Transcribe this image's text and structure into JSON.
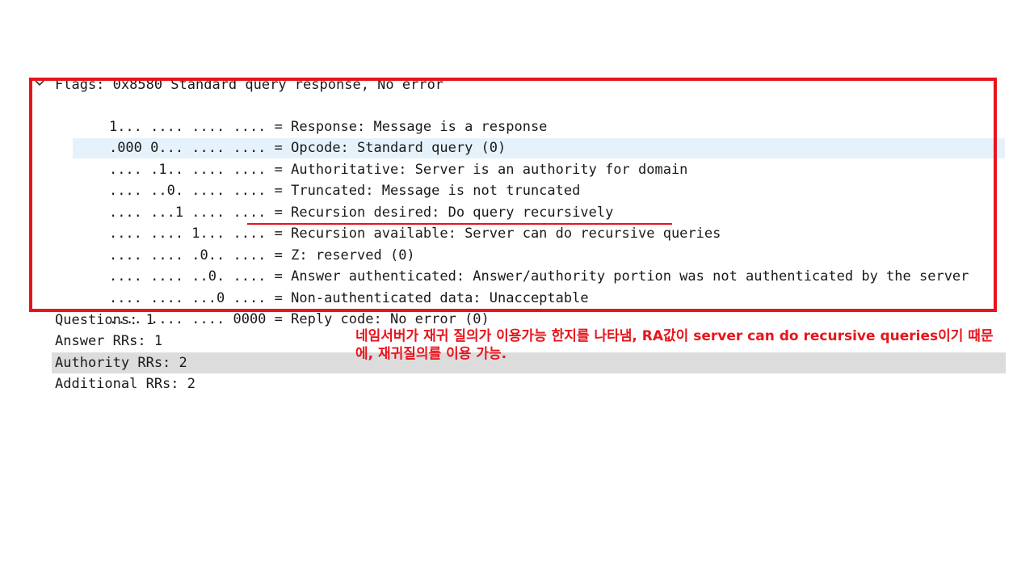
{
  "packet_details": {
    "flags_header": "Flags: 0x8580 Standard query response, No error",
    "flags": [
      {
        "bits": "1... .... .... ....",
        "desc": "Response: Message is a response"
      },
      {
        "bits": ".000 0... .... ....",
        "desc": "Opcode: Standard query (0)"
      },
      {
        "bits": ".... .1.. .... ....",
        "desc": "Authoritative: Server is an authority for domain"
      },
      {
        "bits": ".... ..0. .... ....",
        "desc": "Truncated: Message is not truncated"
      },
      {
        "bits": ".... ...1 .... ....",
        "desc": "Recursion desired: Do query recursively"
      },
      {
        "bits": ".... .... 1... ....",
        "desc": "Recursion available: Server can do recursive queries"
      },
      {
        "bits": ".... .... .0.. ....",
        "desc": "Z: reserved (0)"
      },
      {
        "bits": ".... .... ..0. ....",
        "desc": "Answer authenticated: Answer/authority portion was not authenticated by the server"
      },
      {
        "bits": ".... .... ...0 ....",
        "desc": "Non-authenticated data: Unacceptable"
      },
      {
        "bits": ".... .... .... 0000",
        "desc": "Reply code: No error (0)"
      }
    ],
    "counts": [
      {
        "label": "Questions: 1"
      },
      {
        "label": "Answer RRs: 1"
      },
      {
        "label": "Authority RRs: 2"
      },
      {
        "label": "Additional RRs: 2"
      }
    ]
  },
  "annotation": {
    "text": "네임서버가 재귀 질의가 이용가능 한지를 나타냄, RA값이 server can do recursive queries이기 때문에, 재귀질의를 이용 가능.",
    "color": "#e8141c"
  },
  "colors": {
    "selected_row": "#e6f2fb",
    "gray_row": "#dcdcdc",
    "box": "#e8141c"
  }
}
